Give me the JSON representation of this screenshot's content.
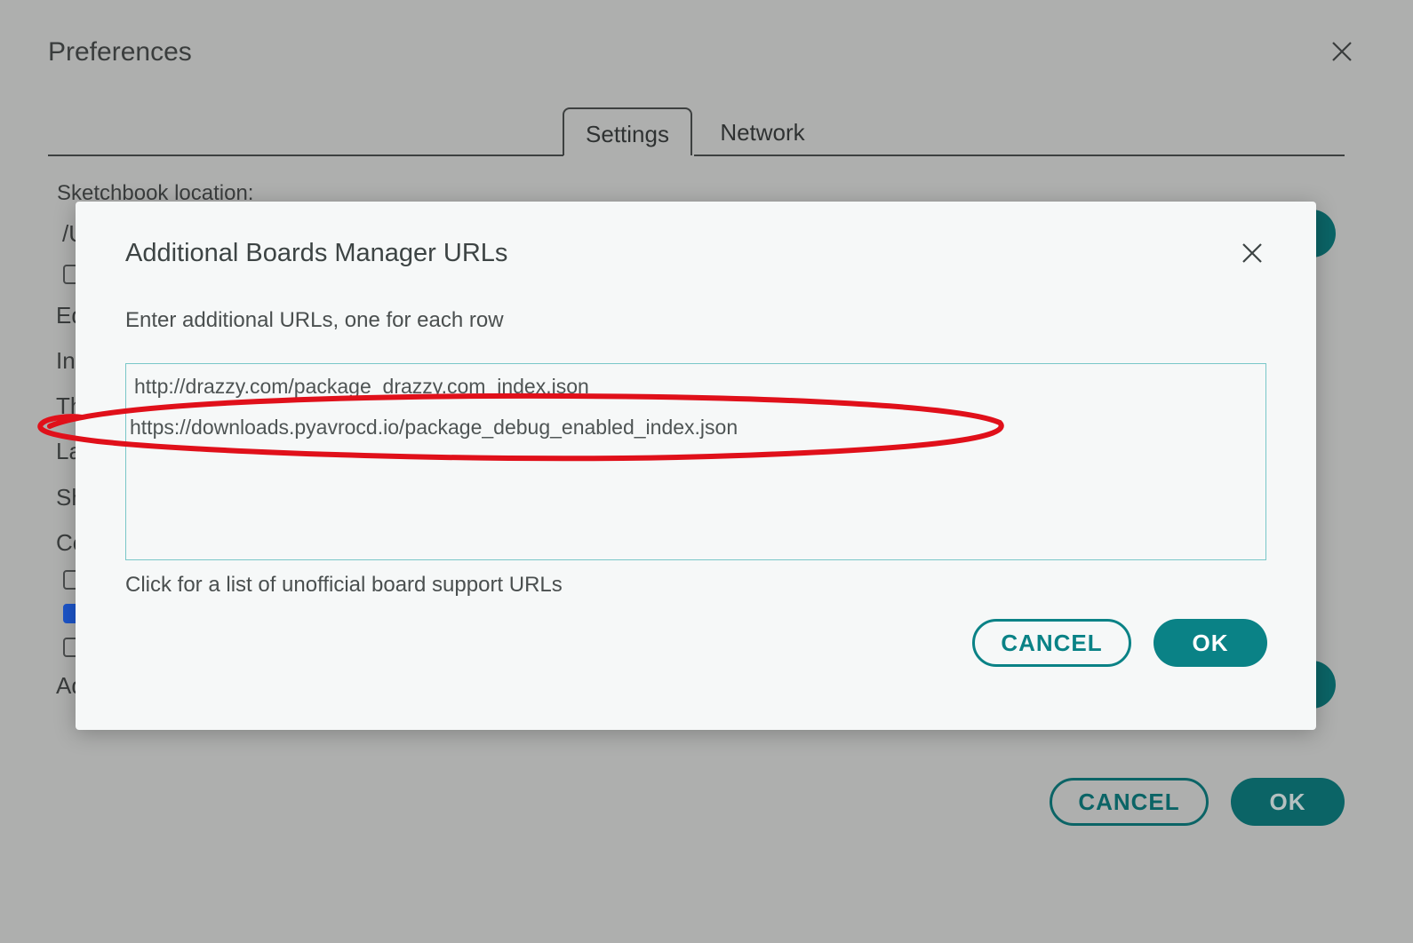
{
  "preferences": {
    "title": "Preferences",
    "tabs": [
      {
        "label": "Settings",
        "active": true
      },
      {
        "label": "Network",
        "active": false
      }
    ],
    "sketchbook_label": "Sketchbook location:",
    "sketchbook_value_peek": "/U",
    "peek_labels": [
      "Ed",
      "In",
      "Th",
      "La",
      "Sh",
      "Co",
      "Ad"
    ],
    "checkbox_states": [
      false,
      false,
      true,
      false
    ],
    "cancel_label": "CANCEL",
    "ok_label": "OK"
  },
  "dialog": {
    "title": "Additional Boards Manager URLs",
    "instruction": "Enter additional URLs, one for each row",
    "urls": [
      "http://drazzy.com/package_drazzy.com_index.json",
      "https://downloads.pyavrocd.io/package_debug_enabled_index.json"
    ],
    "link_text": "Click for a list of unofficial board support URLs",
    "cancel_label": "CANCEL",
    "ok_label": "OK"
  },
  "colors": {
    "accent": "#0a8286",
    "accent_dim": "#0b6466",
    "overlay_background": "#aeafae",
    "annotation": "#e0101a"
  },
  "icons": {
    "close": "close-icon"
  }
}
